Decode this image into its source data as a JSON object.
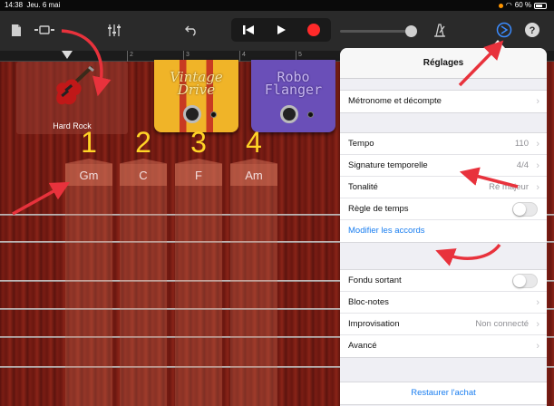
{
  "status": {
    "time": "14:38",
    "date": "Jeu. 6 mai",
    "battery": "60 %"
  },
  "toolbar": {
    "icons": [
      "document-icon",
      "view-toggle-icon",
      "mixer-icon",
      "undo-icon",
      "rewind-icon",
      "play-icon",
      "record-icon",
      "metronome-icon",
      "settings-icon",
      "help-icon"
    ]
  },
  "ruler": {
    "marks": [
      "2",
      "3",
      "4",
      "5"
    ]
  },
  "instrument": {
    "name": "Hard Rock"
  },
  "pedals": [
    {
      "name": "Vintage Drive",
      "line1": "Vintage",
      "line2": "Drive",
      "color": "#f0b428"
    },
    {
      "name": "Robo Flanger",
      "line1": "Robo",
      "line2": "Flanger",
      "color": "#6a4fb8"
    }
  ],
  "chords": [
    {
      "number": "1",
      "name": "Gm"
    },
    {
      "number": "2",
      "name": "C"
    },
    {
      "number": "3",
      "name": "F"
    },
    {
      "number": "4",
      "name": "Am"
    }
  ],
  "settings": {
    "title": "Réglages",
    "metronome": "Métronome et décompte",
    "tempo_label": "Tempo",
    "tempo_value": "110",
    "signature_label": "Signature temporelle",
    "signature_value": "4/4",
    "key_label": "Tonalité",
    "key_value": "Ré majeur",
    "time_ruler_label": "Règle de temps",
    "edit_chords": "Modifier les accords",
    "fade_out_label": "Fondu sortant",
    "notes_label": "Bloc-notes",
    "improvisation_label": "Improvisation",
    "improvisation_value": "Non connecté",
    "advanced_label": "Avancé",
    "restore_purchase": "Restaurer l'achat"
  },
  "colors": {
    "accent": "#1a7ef0",
    "annotation": "#e8323c",
    "chord_number": "#ffd426"
  }
}
